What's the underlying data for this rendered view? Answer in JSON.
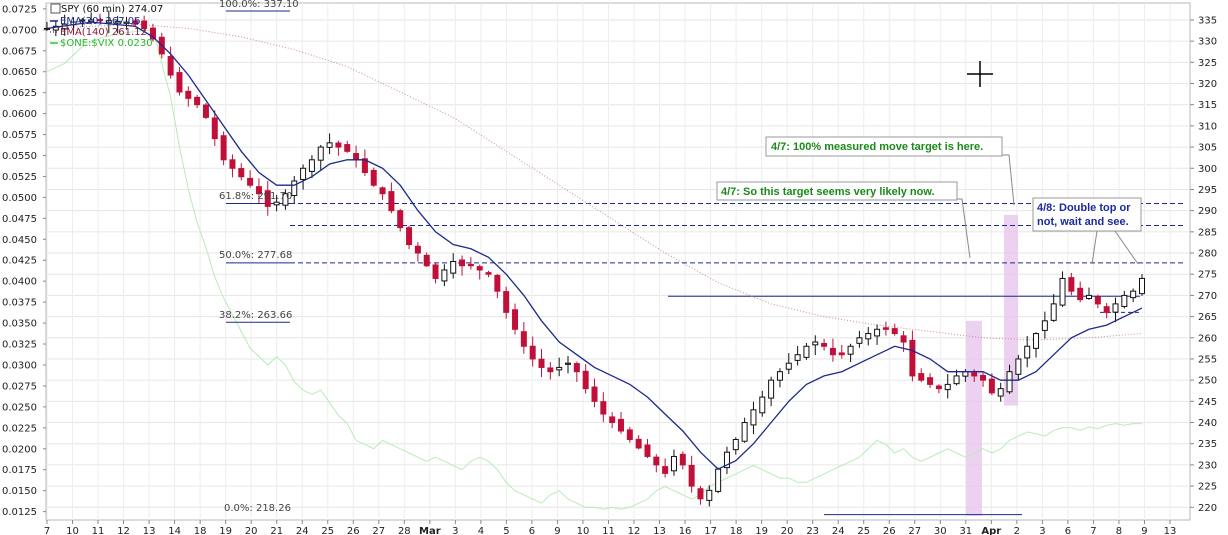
{
  "chart_data": {
    "type": "candlestick",
    "symbol_label": "SPY (60 min) 274.07",
    "legend": [
      {
        "name": "EMA(20) 267.06",
        "color": "#1c2a8a",
        "style": "solid"
      },
      {
        "name": "EMA(140) 261.12",
        "color": "#b03060",
        "style": "dotted"
      },
      {
        "name": "$ONE:$VIX 0.0230",
        "color": "#22cc22",
        "style": "solid"
      }
    ],
    "x_ticks": [
      "7",
      "10",
      "11",
      "12",
      "13",
      "14",
      "18",
      "19",
      "20",
      "21",
      "24",
      "25",
      "26",
      "27",
      "28",
      "Mar",
      "3",
      "4",
      "5",
      "6",
      "9",
      "10",
      "11",
      "12",
      "13",
      "16",
      "17",
      "18",
      "19",
      "20",
      "23",
      "24",
      "25",
      "26",
      "27",
      "30",
      "31",
      "Apr",
      "2",
      "3",
      "6",
      "7",
      "8",
      "9",
      "13"
    ],
    "right_axis": {
      "range": [
        217,
        339
      ],
      "ticks": [
        220,
        225,
        230,
        235,
        240,
        245,
        250,
        255,
        260,
        265,
        270,
        275,
        280,
        285,
        290,
        295,
        300,
        305,
        310,
        315,
        320,
        325,
        330,
        335
      ]
    },
    "left_axis": {
      "range": [
        0.0115,
        0.0732
      ],
      "ticks": [
        "0.0125",
        "0.0150",
        "0.0175",
        "0.0200",
        "0.0225",
        "0.0250",
        "0.0275",
        "0.0300",
        "0.0325",
        "0.0350",
        "0.0375",
        "0.0400",
        "0.0425",
        "0.0450",
        "0.0475",
        "0.0500",
        "0.0525",
        "0.0550",
        "0.0575",
        "0.0600",
        "0.0625",
        "0.0650",
        "0.0675",
        "0.0700",
        "0.0725"
      ]
    },
    "fib_levels": [
      {
        "label": "100.0%: 337.10",
        "value": 337.1,
        "dashed": false
      },
      {
        "label": "61.8%: 291.70",
        "value": 291.7,
        "dashed": true
      },
      {
        "label": "50.0%: 277.68",
        "value": 277.68,
        "dashed": true
      },
      {
        "label": "38.2%: 263.66",
        "value": 263.66,
        "dashed": false
      },
      {
        "label": "0.0%: 218.26",
        "value": 218.26,
        "dashed": false
      }
    ],
    "extra_level": 286.5,
    "annotations": [
      {
        "text": "4/7: 100% measured move target is here.",
        "color": "#1a8a1a"
      },
      {
        "text": "4/7: So this target seems very likely now.",
        "color": "#1a8a1a"
      },
      {
        "text": "4/8: Double top or",
        "color": "#1c2aa0"
      },
      {
        "text": "not, wait and see.",
        "color": "#1c2aa0"
      }
    ],
    "close_path": [
      [
        0,
        333
      ],
      [
        2,
        334
      ],
      [
        4,
        335
      ],
      [
        6,
        335
      ],
      [
        9,
        334.5
      ],
      [
        10,
        334
      ],
      [
        11,
        333
      ],
      [
        12,
        330.5
      ],
      [
        13,
        327
      ],
      [
        14,
        322
      ],
      [
        15,
        318
      ],
      [
        17,
        315
      ],
      [
        18,
        312
      ],
      [
        19,
        307
      ],
      [
        20,
        302
      ],
      [
        22,
        298
      ],
      [
        24,
        294
      ],
      [
        25,
        291
      ],
      [
        26,
        292
      ],
      [
        27,
        294
      ],
      [
        28,
        297
      ],
      [
        29,
        300
      ],
      [
        30,
        302
      ],
      [
        31,
        305
      ],
      [
        32,
        306
      ],
      [
        33,
        305
      ],
      [
        34,
        304
      ],
      [
        35,
        302
      ],
      [
        36,
        299
      ],
      [
        37,
        296
      ],
      [
        38,
        294
      ],
      [
        39,
        290
      ],
      [
        40,
        286
      ],
      [
        41,
        282
      ],
      [
        42,
        280
      ],
      [
        43,
        277
      ],
      [
        44,
        274
      ],
      [
        45,
        276
      ],
      [
        46,
        278
      ],
      [
        47,
        277
      ],
      [
        48,
        277
      ],
      [
        49,
        276
      ],
      [
        50,
        275
      ],
      [
        51,
        271
      ],
      [
        52,
        266
      ],
      [
        53,
        262
      ],
      [
        54,
        258
      ],
      [
        55,
        255
      ],
      [
        56,
        253
      ],
      [
        57,
        252
      ],
      [
        59,
        254
      ],
      [
        60,
        252
      ],
      [
        61,
        248
      ],
      [
        62,
        245
      ],
      [
        63,
        242
      ],
      [
        64,
        240
      ],
      [
        65,
        238
      ],
      [
        66,
        236
      ],
      [
        67,
        234
      ],
      [
        68,
        232
      ],
      [
        69,
        230
      ],
      [
        70,
        228
      ],
      [
        71,
        232
      ],
      [
        72,
        230
      ],
      [
        73,
        225
      ],
      [
        74,
        222
      ],
      [
        75,
        224
      ],
      [
        76,
        229
      ],
      [
        77,
        233
      ],
      [
        78,
        236
      ],
      [
        79,
        240
      ],
      [
        80,
        243
      ],
      [
        81,
        246
      ],
      [
        82,
        250
      ],
      [
        83,
        252
      ],
      [
        84,
        254
      ],
      [
        85,
        256
      ],
      [
        86,
        258
      ],
      [
        87,
        259
      ],
      [
        88,
        258
      ],
      [
        89,
        256
      ],
      [
        90,
        256
      ],
      [
        91,
        258
      ],
      [
        92,
        260
      ],
      [
        93,
        261
      ],
      [
        94,
        262
      ],
      [
        95,
        262
      ],
      [
        96,
        261
      ],
      [
        97,
        259
      ],
      [
        98,
        251
      ],
      [
        99,
        250
      ],
      [
        100,
        249
      ],
      [
        101,
        248
      ],
      [
        102,
        249
      ],
      [
        103,
        251
      ],
      [
        104,
        252
      ],
      [
        105,
        251
      ],
      [
        106,
        250
      ],
      [
        107,
        247
      ],
      [
        108,
        248
      ],
      [
        109,
        252
      ],
      [
        110,
        255
      ],
      [
        111,
        258
      ],
      [
        112,
        261
      ],
      [
        113,
        264
      ],
      [
        114,
        268
      ],
      [
        115,
        274
      ],
      [
        116,
        271
      ],
      [
        117,
        269
      ],
      [
        118,
        270
      ],
      [
        119,
        268
      ],
      [
        120,
        266
      ],
      [
        121,
        268
      ],
      [
        122,
        270
      ],
      [
        123,
        271
      ],
      [
        124,
        274
      ]
    ],
    "ema20_path": [
      [
        0,
        333
      ],
      [
        5,
        334.5
      ],
      [
        10,
        333.5
      ],
      [
        12,
        331
      ],
      [
        14,
        327
      ],
      [
        16,
        322
      ],
      [
        18,
        316
      ],
      [
        20,
        310
      ],
      [
        22,
        304
      ],
      [
        24,
        299
      ],
      [
        26,
        296
      ],
      [
        28,
        296
      ],
      [
        30,
        298
      ],
      [
        32,
        301
      ],
      [
        34,
        302
      ],
      [
        36,
        302
      ],
      [
        38,
        300
      ],
      [
        40,
        296
      ],
      [
        42,
        290
      ],
      [
        44,
        285
      ],
      [
        46,
        282
      ],
      [
        48,
        281
      ],
      [
        50,
        279
      ],
      [
        52,
        275
      ],
      [
        54,
        270
      ],
      [
        56,
        264
      ],
      [
        58,
        259
      ],
      [
        60,
        256
      ],
      [
        62,
        253
      ],
      [
        64,
        251
      ],
      [
        66,
        249
      ],
      [
        68,
        246
      ],
      [
        70,
        242
      ],
      [
        72,
        238
      ],
      [
        74,
        233
      ],
      [
        76,
        229
      ],
      [
        78,
        231
      ],
      [
        80,
        235
      ],
      [
        82,
        240
      ],
      [
        84,
        245
      ],
      [
        86,
        249
      ],
      [
        88,
        251
      ],
      [
        90,
        252
      ],
      [
        92,
        254
      ],
      [
        94,
        256
      ],
      [
        96,
        258
      ],
      [
        98,
        257
      ],
      [
        100,
        255
      ],
      [
        102,
        252
      ],
      [
        104,
        252
      ],
      [
        106,
        252
      ],
      [
        108,
        250
      ],
      [
        110,
        250
      ],
      [
        112,
        252
      ],
      [
        114,
        256
      ],
      [
        116,
        260
      ],
      [
        118,
        262
      ],
      [
        120,
        263
      ],
      [
        122,
        265
      ],
      [
        124,
        267
      ]
    ],
    "ema140_path": [
      [
        0,
        333
      ],
      [
        10,
        334
      ],
      [
        16,
        333
      ],
      [
        22,
        331
      ],
      [
        28,
        328
      ],
      [
        34,
        324
      ],
      [
        40,
        318
      ],
      [
        46,
        312
      ],
      [
        52,
        304
      ],
      [
        58,
        296
      ],
      [
        64,
        288
      ],
      [
        70,
        280
      ],
      [
        76,
        273
      ],
      [
        82,
        268
      ],
      [
        88,
        265
      ],
      [
        94,
        263
      ],
      [
        100,
        261.5
      ],
      [
        106,
        260
      ],
      [
        112,
        259.5
      ],
      [
        118,
        260
      ],
      [
        124,
        261
      ]
    ],
    "vix_path": [
      [
        0,
        0.065
      ],
      [
        2,
        0.066
      ],
      [
        4,
        0.068
      ],
      [
        6,
        0.069
      ],
      [
        8,
        0.0695
      ],
      [
        10,
        0.0698
      ],
      [
        12,
        0.07
      ],
      [
        13,
        0.066
      ],
      [
        14,
        0.062
      ],
      [
        15,
        0.056
      ],
      [
        16,
        0.051
      ],
      [
        17,
        0.047
      ],
      [
        18,
        0.044
      ],
      [
        19,
        0.0405
      ],
      [
        20,
        0.038
      ],
      [
        21,
        0.036
      ],
      [
        22,
        0.034
      ],
      [
        23,
        0.032
      ],
      [
        24,
        0.031
      ],
      [
        25,
        0.03
      ],
      [
        26,
        0.031
      ],
      [
        27,
        0.03
      ],
      [
        28,
        0.028
      ],
      [
        29,
        0.027
      ],
      [
        30,
        0.0265
      ],
      [
        31,
        0.027
      ],
      [
        32,
        0.0255
      ],
      [
        33,
        0.024
      ],
      [
        34,
        0.023
      ],
      [
        35,
        0.021
      ],
      [
        36,
        0.0205
      ],
      [
        37,
        0.02
      ],
      [
        38,
        0.021
      ],
      [
        39,
        0.0205
      ],
      [
        40,
        0.02
      ],
      [
        41,
        0.0195
      ],
      [
        42,
        0.019
      ],
      [
        43,
        0.0185
      ],
      [
        44,
        0.019
      ],
      [
        45,
        0.0185
      ],
      [
        46,
        0.018
      ],
      [
        47,
        0.0175
      ],
      [
        48,
        0.0185
      ],
      [
        49,
        0.019
      ],
      [
        50,
        0.0185
      ],
      [
        51,
        0.0175
      ],
      [
        52,
        0.016
      ],
      [
        53,
        0.015
      ],
      [
        54,
        0.0145
      ],
      [
        55,
        0.014
      ],
      [
        56,
        0.0135
      ],
      [
        57,
        0.0145
      ],
      [
        58,
        0.015
      ],
      [
        59,
        0.014
      ],
      [
        60,
        0.0135
      ],
      [
        61,
        0.013
      ],
      [
        62,
        0.013
      ],
      [
        63,
        0.0128
      ],
      [
        64,
        0.013
      ],
      [
        65,
        0.0128
      ],
      [
        66,
        0.013
      ],
      [
        67,
        0.0135
      ],
      [
        68,
        0.014
      ],
      [
        69,
        0.015
      ],
      [
        70,
        0.0155
      ],
      [
        71,
        0.015
      ],
      [
        72,
        0.0145
      ],
      [
        73,
        0.014
      ],
      [
        74,
        0.0145
      ],
      [
        75,
        0.0155
      ],
      [
        76,
        0.016
      ],
      [
        77,
        0.0165
      ],
      [
        78,
        0.017
      ],
      [
        79,
        0.0175
      ],
      [
        80,
        0.018
      ],
      [
        81,
        0.0175
      ],
      [
        82,
        0.017
      ],
      [
        83,
        0.0165
      ],
      [
        84,
        0.0165
      ],
      [
        85,
        0.016
      ],
      [
        86,
        0.016
      ],
      [
        87,
        0.0165
      ],
      [
        88,
        0.017
      ],
      [
        89,
        0.0175
      ],
      [
        90,
        0.018
      ],
      [
        91,
        0.0185
      ],
      [
        92,
        0.019
      ],
      [
        93,
        0.02
      ],
      [
        94,
        0.021
      ],
      [
        95,
        0.0205
      ],
      [
        96,
        0.0195
      ],
      [
        97,
        0.02
      ],
      [
        98,
        0.019
      ],
      [
        99,
        0.0185
      ],
      [
        100,
        0.019
      ],
      [
        101,
        0.0195
      ],
      [
        102,
        0.02
      ],
      [
        103,
        0.0195
      ],
      [
        104,
        0.019
      ],
      [
        105,
        0.0195
      ],
      [
        106,
        0.02
      ],
      [
        107,
        0.0195
      ],
      [
        108,
        0.02
      ],
      [
        109,
        0.021
      ],
      [
        110,
        0.0215
      ],
      [
        111,
        0.022
      ],
      [
        112,
        0.0218
      ],
      [
        113,
        0.0215
      ],
      [
        114,
        0.0222
      ],
      [
        115,
        0.0225
      ],
      [
        116,
        0.0225
      ],
      [
        117,
        0.0222
      ],
      [
        118,
        0.0226
      ],
      [
        119,
        0.0224
      ],
      [
        120,
        0.0228
      ],
      [
        121,
        0.023
      ],
      [
        122,
        0.0228
      ],
      [
        123,
        0.023
      ],
      [
        124,
        0.023
      ]
    ]
  }
}
